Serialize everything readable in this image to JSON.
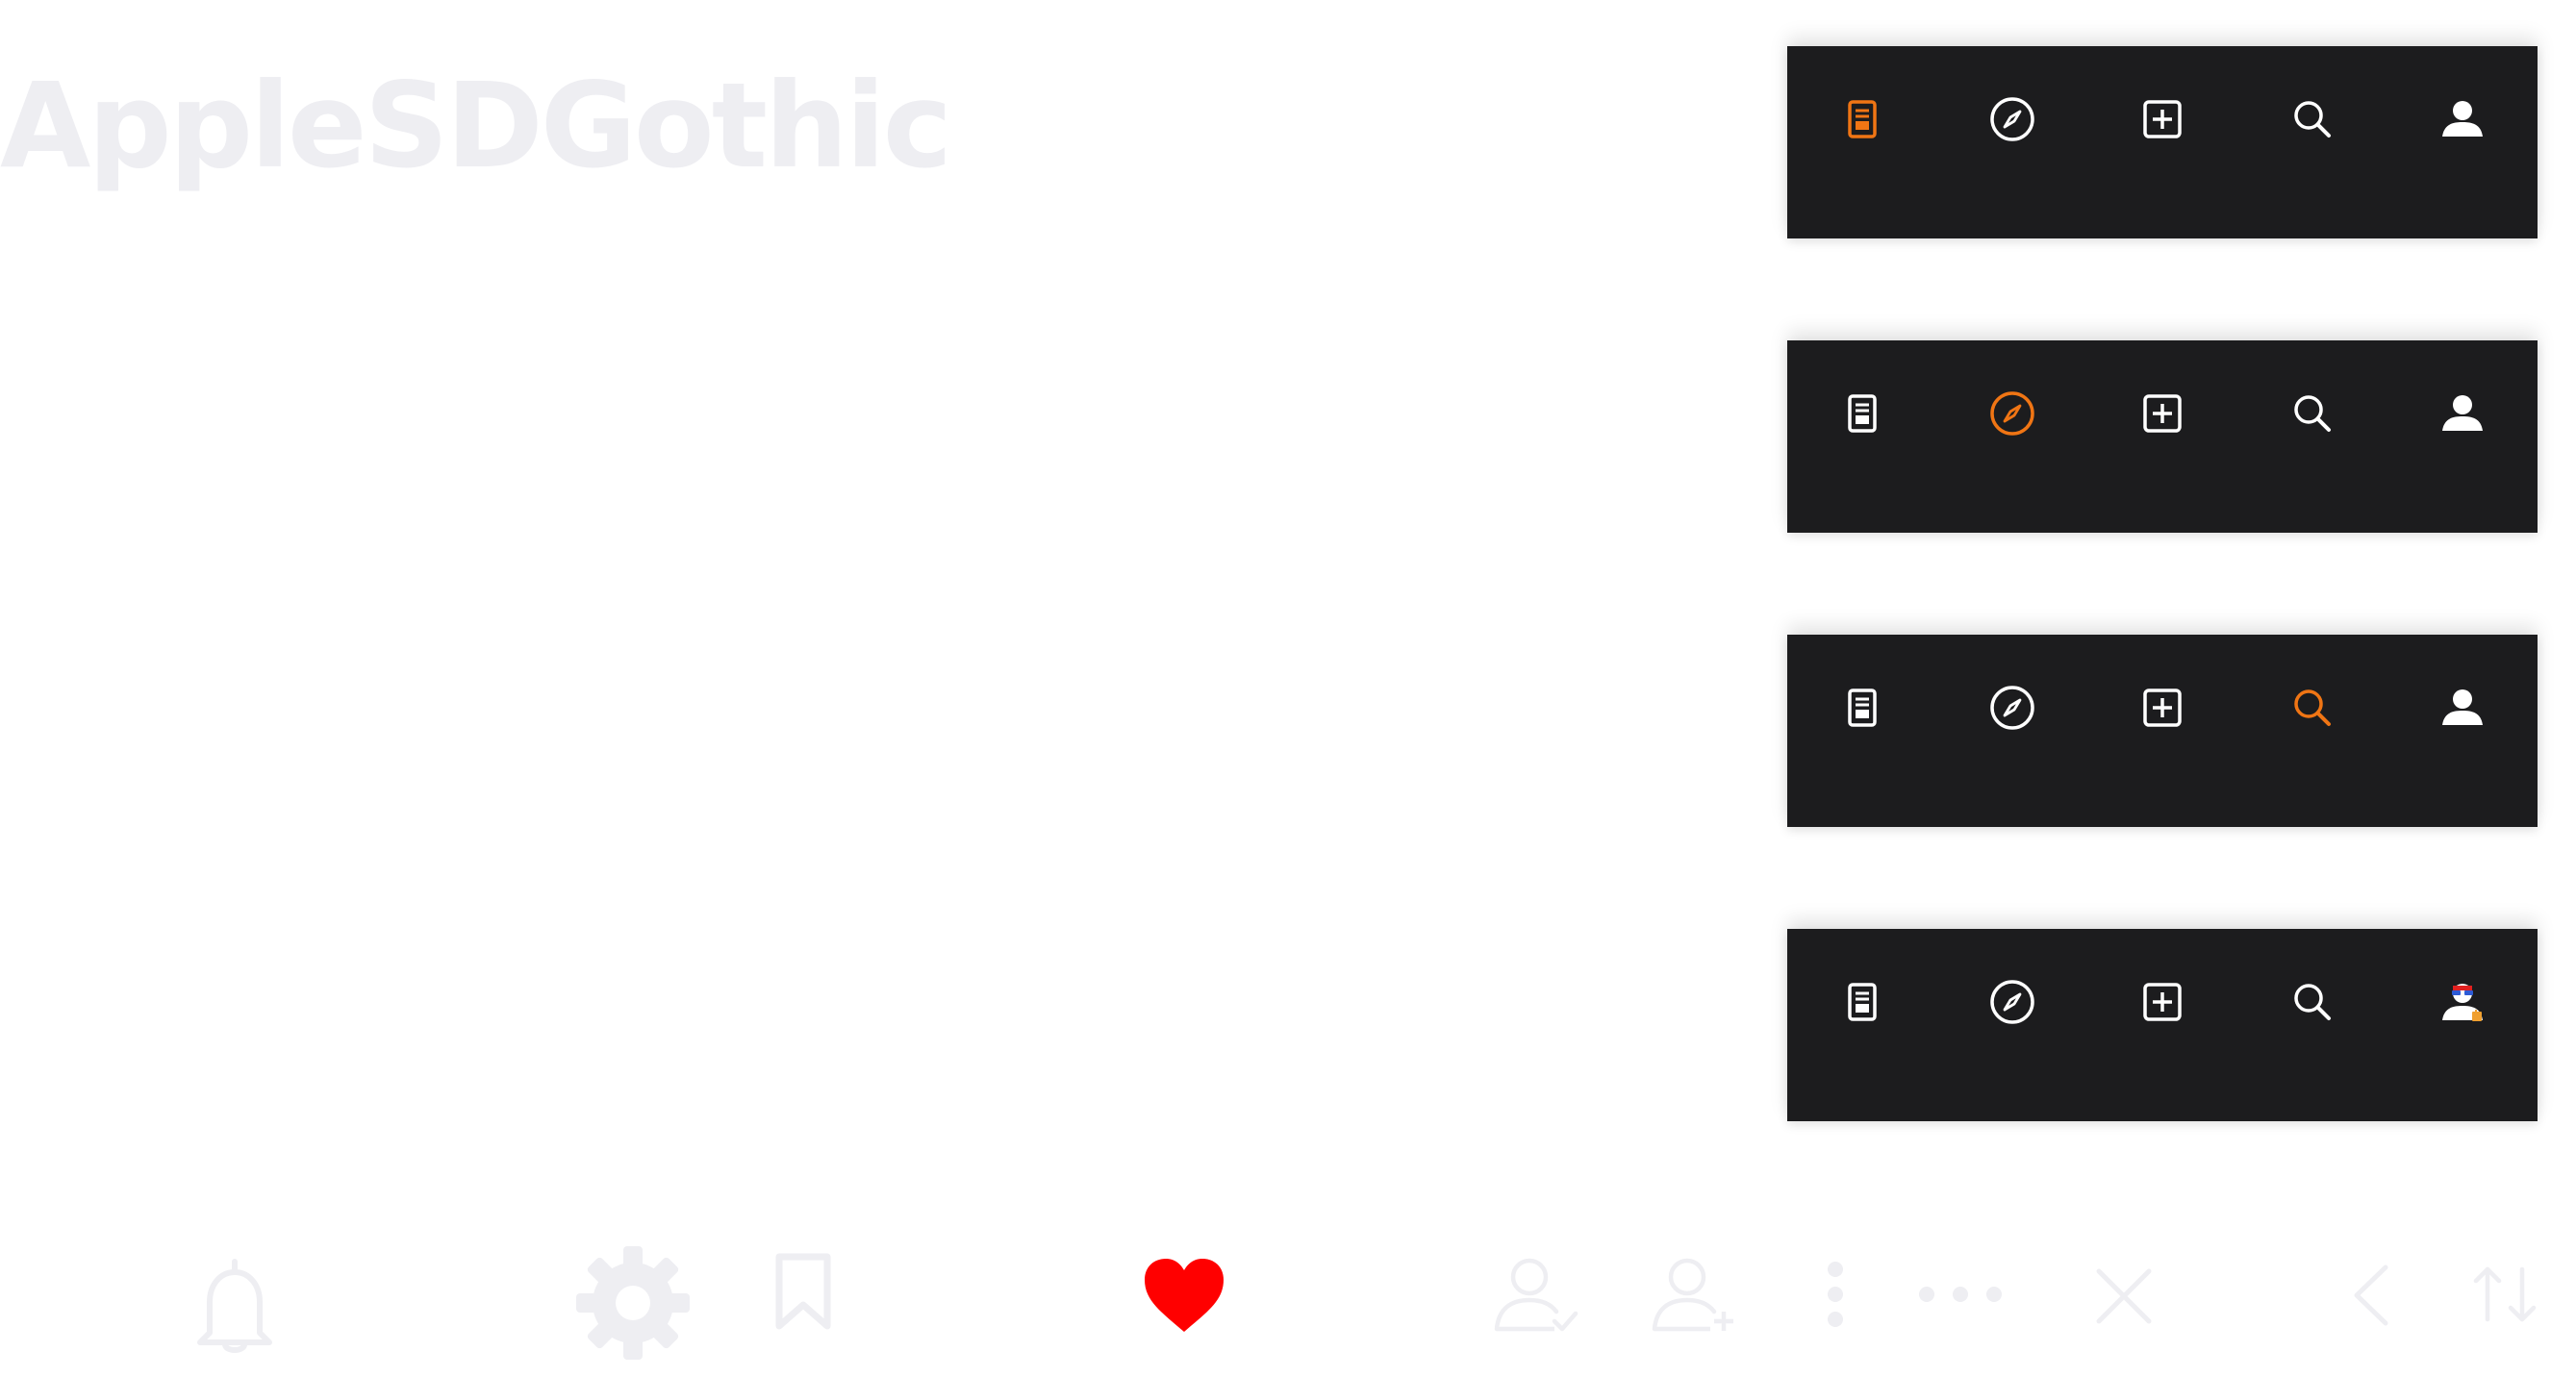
{
  "font_name": "AppleSDGothic",
  "colors": {
    "active": "#f07514",
    "inactive": "#ffffff",
    "bar_background": "#1c1c1e",
    "faint_icon": "#eeeef2",
    "heart": "#ff0000"
  },
  "tab_bars": [
    {
      "active_tab": "feed",
      "tabs": [
        "feed-icon",
        "compass-icon",
        "add-post-icon",
        "search-icon",
        "profile-icon"
      ]
    },
    {
      "active_tab": "explore",
      "tabs": [
        "feed-icon",
        "compass-icon",
        "add-post-icon",
        "search-icon",
        "profile-icon"
      ]
    },
    {
      "active_tab": "search",
      "tabs": [
        "feed-icon",
        "compass-icon",
        "add-post-icon",
        "search-icon",
        "profile-icon"
      ]
    },
    {
      "active_tab": "profile",
      "tabs": [
        "feed-icon",
        "compass-icon",
        "add-post-icon",
        "search-icon",
        "avatar-icon"
      ]
    }
  ],
  "bottom_icons": [
    "bell-icon",
    "gear-icon",
    "bookmark-icon",
    "heart-icon",
    "user-check-icon",
    "user-add-icon",
    "more-vertical-icon",
    "more-horizontal-icon",
    "close-icon",
    "chevron-left-icon",
    "sort-icon"
  ]
}
